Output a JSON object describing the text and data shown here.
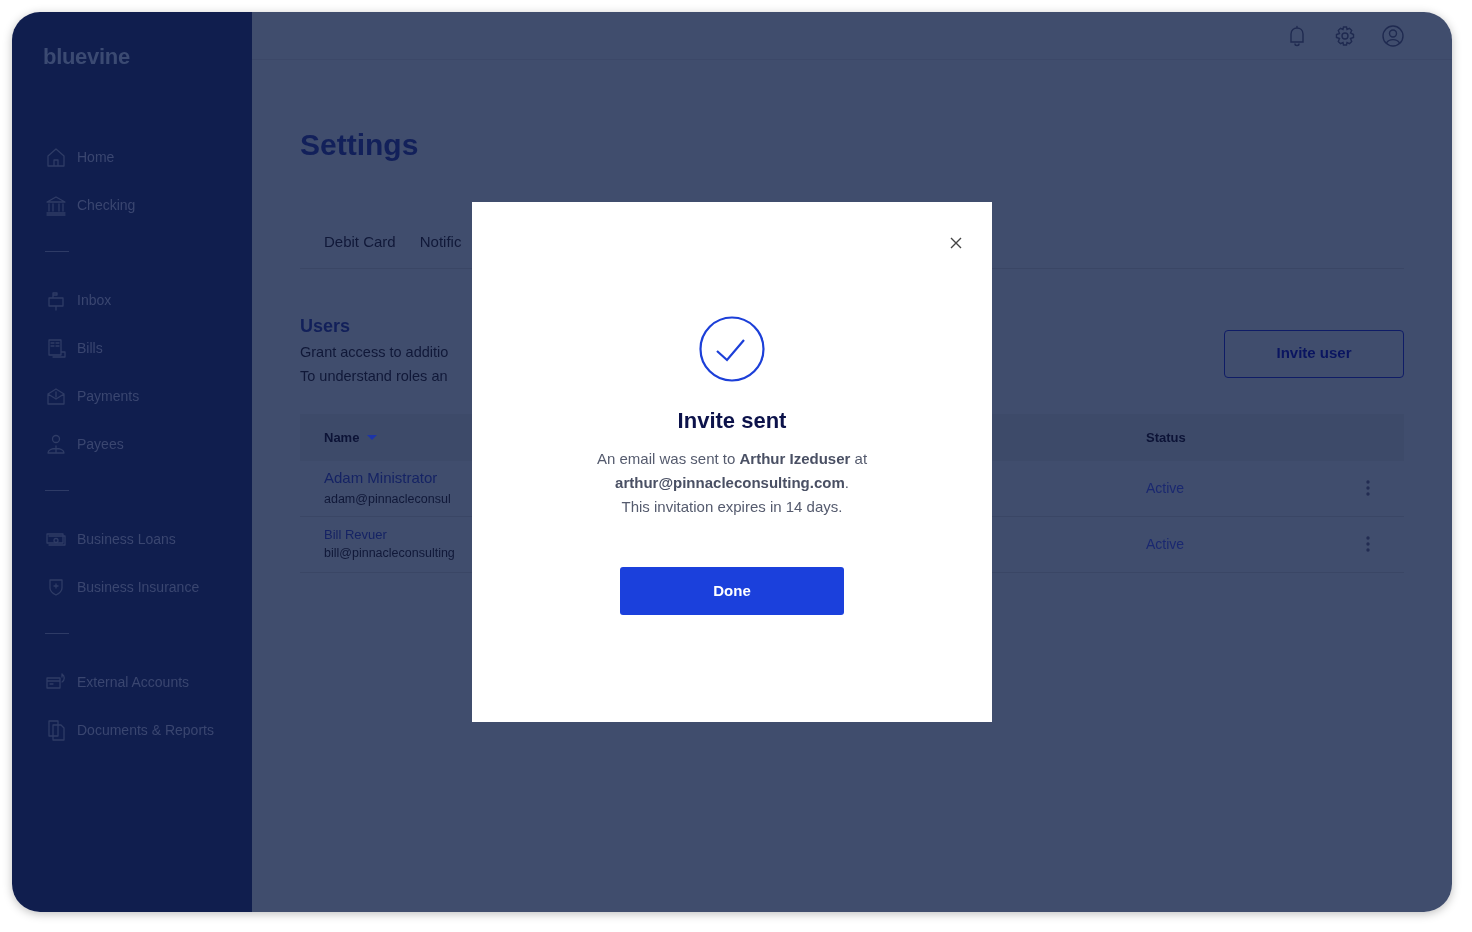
{
  "sidebar": {
    "logo": "bluevine",
    "sections": [
      [
        {
          "label": "Home"
        },
        {
          "label": "Checking"
        }
      ],
      [
        {
          "label": "Inbox"
        },
        {
          "label": "Bills"
        },
        {
          "label": "Payments"
        },
        {
          "label": "Payees"
        }
      ],
      [
        {
          "label": "Business Loans"
        },
        {
          "label": "Business Insurance"
        }
      ],
      [
        {
          "label": "External Accounts"
        },
        {
          "label": "Documents & Reports"
        }
      ]
    ]
  },
  "page": {
    "title": "Settings",
    "tabs": [
      {
        "label": "Debit Card",
        "selected": false
      },
      {
        "label": "Notific",
        "selected": false
      }
    ],
    "users": {
      "heading": "Users",
      "description": [
        "Grant access to additio",
        "To understand roles an"
      ],
      "invite_button": "Invite user"
    },
    "table": {
      "columns": [
        {
          "label": "Name",
          "sorted": true
        },
        {
          "label": "Status",
          "sorted": false
        }
      ],
      "rows": [
        {
          "name": "Adam Ministrator",
          "email": "adam@pinnacleconsul",
          "status": "Active"
        },
        {
          "name": "Bill Revuer",
          "email": "bill@pinnacleconsulting",
          "status": "Active"
        }
      ]
    }
  },
  "modal": {
    "title": "Invite sent",
    "message_lines": [
      "An email was sent to **Arthur Izeduser** at",
      "**arthur@pinnacleconsulting.com**.",
      "This invitation expires in 14 days."
    ],
    "button": "Done"
  }
}
